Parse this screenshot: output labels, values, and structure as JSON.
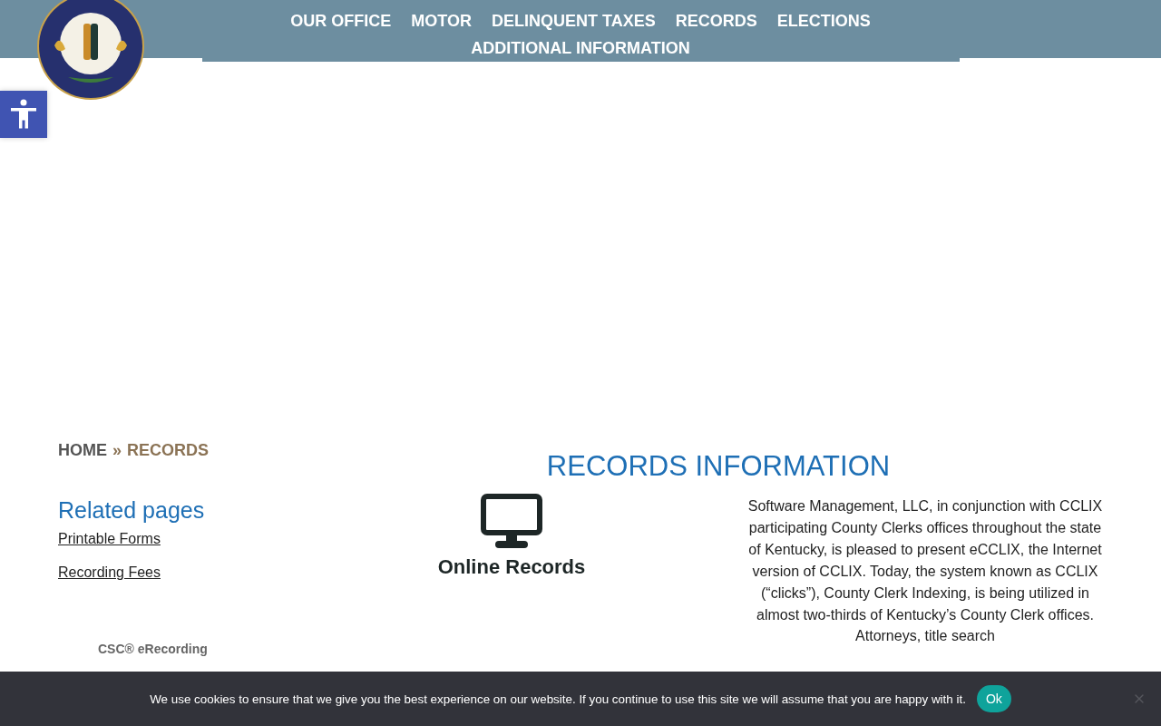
{
  "nav": [
    "OUR OFFICE",
    "MOTOR",
    "DELINQUENT TAXES",
    "RECORDS",
    "ELECTIONS",
    "ADDITIONAL INFORMATION"
  ],
  "breadcrumb": {
    "home": "HOME",
    "separator": "»",
    "current": "RECORDS"
  },
  "sidebar": {
    "heading": "Related pages",
    "links": [
      "Printable Forms",
      "Recording Fees"
    ],
    "partner": "CSC® eRecording"
  },
  "main": {
    "title": "RECORDS INFORMATION",
    "feature": "Online Records",
    "paragraph": "Software Management, LLC, in conjunction with CCLIX participating County Clerks offices throughout the state of Kentucky, is pleased to present eCCLIX, the Internet version of CCLIX. Today, the system known as CCLIX (“clicks”), County Clerk Indexing, is being utilized in almost two-thirds of Kentucky’s County Clerk offices. Attorneys, title search"
  },
  "cookie": {
    "message": "We use cookies to ensure that we give you the best experience on our website. If you continue to use this site we will assume that you are happy with it.",
    "button": "Ok"
  }
}
